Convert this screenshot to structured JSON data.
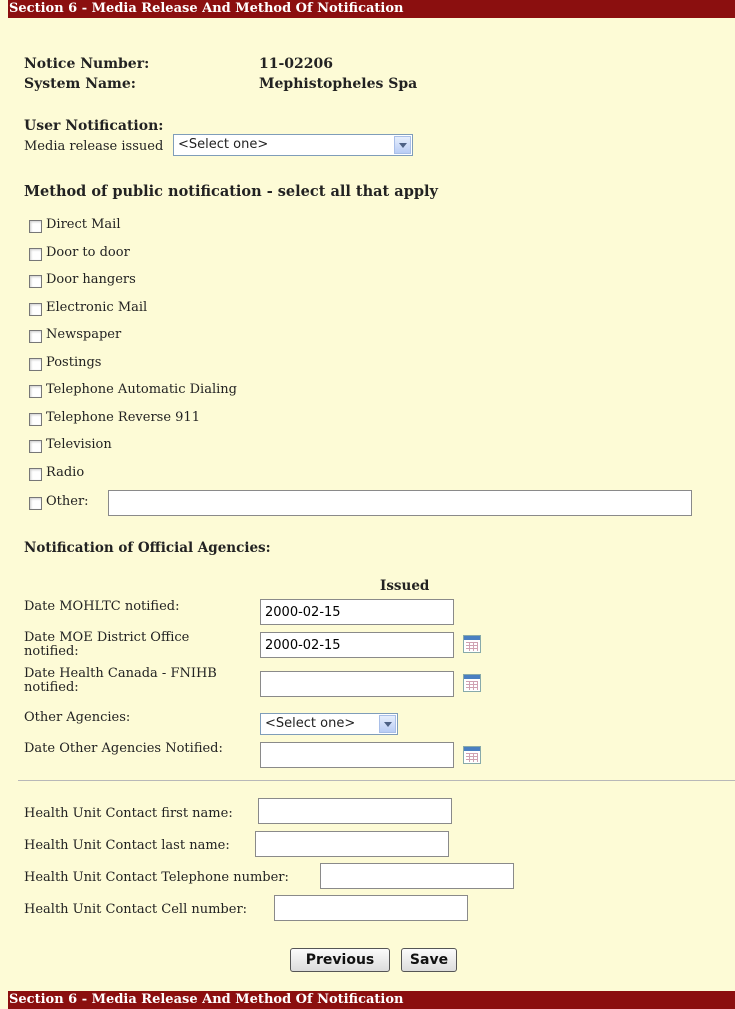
{
  "section_title": "Section 6 - Media Release And Method Of Notification",
  "notice": {
    "number_label": "Notice Number:",
    "number_value": "11-02206",
    "system_label": "System Name:",
    "system_value": "Mephistopheles Spa"
  },
  "user_notification": {
    "heading": "User Notification:",
    "media_label": "Media release issued",
    "media_value": "<Select one>"
  },
  "methods": {
    "heading": "Method of public notification - select all that apply",
    "items": [
      "Direct Mail",
      "Door to door",
      "Door hangers",
      "Electronic Mail",
      "Newspaper",
      "Postings",
      "Telephone Automatic Dialing",
      "Telephone Reverse 911",
      "Television",
      "Radio",
      "Other:"
    ],
    "other_value": ""
  },
  "agencies": {
    "heading": "Notification of Official Agencies:",
    "issued_header": "Issued",
    "mohltc_label": "Date MOHLTC notified:",
    "mohltc_value": "2000-02-15",
    "moe_label": "Date MOE District Office notified:",
    "moe_value": "2000-02-15",
    "hc_label": "Date Health Canada - FNIHB notified:",
    "hc_value": "",
    "other_label": "Other Agencies:",
    "other_value": "<Select one>",
    "other_date_label": "Date Other Agencies Notified:",
    "other_date_value": ""
  },
  "contact": {
    "first_label": "Health Unit Contact first name:",
    "last_label": "Health Unit Contact last name:",
    "tel_label": "Health Unit Contact Telephone number:",
    "cell_label": "Health Unit Contact Cell number:"
  },
  "buttons": {
    "previous": "Previous",
    "save": "Save"
  }
}
